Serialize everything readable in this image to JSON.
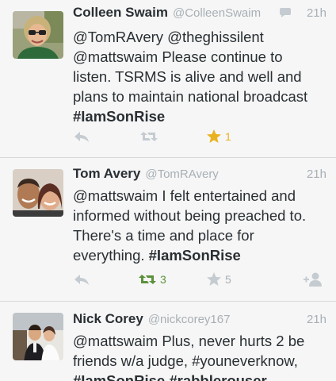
{
  "tweets": [
    {
      "name": "Colleen Swaim",
      "handle": "@ColleenSwaim",
      "time": "21h",
      "text_1": "@TomRAvery @theghissilent",
      "text_2": "@mattswaim Please continue to",
      "text_3": "listen. TSRMS is alive and well and",
      "text_4": "plans to maintain national broadcast",
      "hashtag": "#IamSonRise",
      "favorite_count": "1",
      "retweet_count": "",
      "favorited": true,
      "retweeted": false
    },
    {
      "name": "Tom Avery",
      "handle": "@TomRAvery",
      "time": "21h",
      "text_1": "@mattswaim I felt entertained and",
      "text_2": "informed without being preached to.",
      "text_3": "There's a time and place for",
      "text_4_pre": "everything. ",
      "hashtag": "#IamSonRise",
      "retweet_count": "3",
      "favorite_count": "5",
      "retweeted": true,
      "favorited": false
    },
    {
      "name": "Nick Corey",
      "handle": "@nickcorey167",
      "time": "21h",
      "text_1": "@mattswaim Plus, never hurts 2 be",
      "text_2": "friends w/a judge, #youneverknow,",
      "text_3": "#IamSonRise #rabblerouser"
    }
  ],
  "icons": {
    "reply": "reply-icon",
    "retweet": "retweet-icon",
    "favorite": "star-icon",
    "follow": "follow-icon",
    "conversation": "speech-bubble-icon"
  },
  "colors": {
    "text": "#292f33",
    "muted": "#a8b0b6",
    "retweet_green": "#5c913b",
    "favorite_gold": "#e9b220",
    "background": "#f6f6f6",
    "separator": "#d8d8d8"
  }
}
